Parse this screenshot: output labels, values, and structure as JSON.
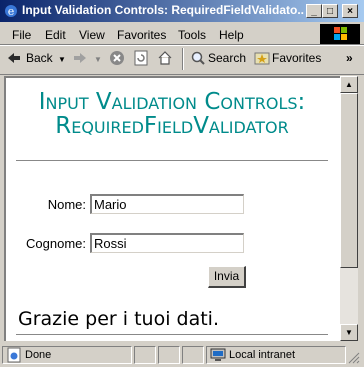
{
  "window": {
    "title": "Input Validation Controls: RequiredFieldValidato..."
  },
  "title_buttons": {
    "minimize": "_",
    "maximize": "□",
    "close": "×"
  },
  "menu": [
    "File",
    "Edit",
    "View",
    "Favorites",
    "Tools",
    "Help"
  ],
  "toolbar": {
    "back": "Back",
    "search": "Search",
    "favorites": "Favorites",
    "more": "»"
  },
  "page": {
    "heading": "Input Validation Controls: RequiredFieldValidator",
    "fields": [
      {
        "label": "Nome:",
        "value": "Mario"
      },
      {
        "label": "Cognome:",
        "value": "Rossi"
      }
    ],
    "submit": "Invia",
    "message": "Grazie per i tuoi dati."
  },
  "status": {
    "text": "Done",
    "zone": "Local intranet"
  },
  "colors": {
    "heading": "#008b8b",
    "titlebar_start": "#0a246a",
    "titlebar_end": "#a6caf0"
  }
}
